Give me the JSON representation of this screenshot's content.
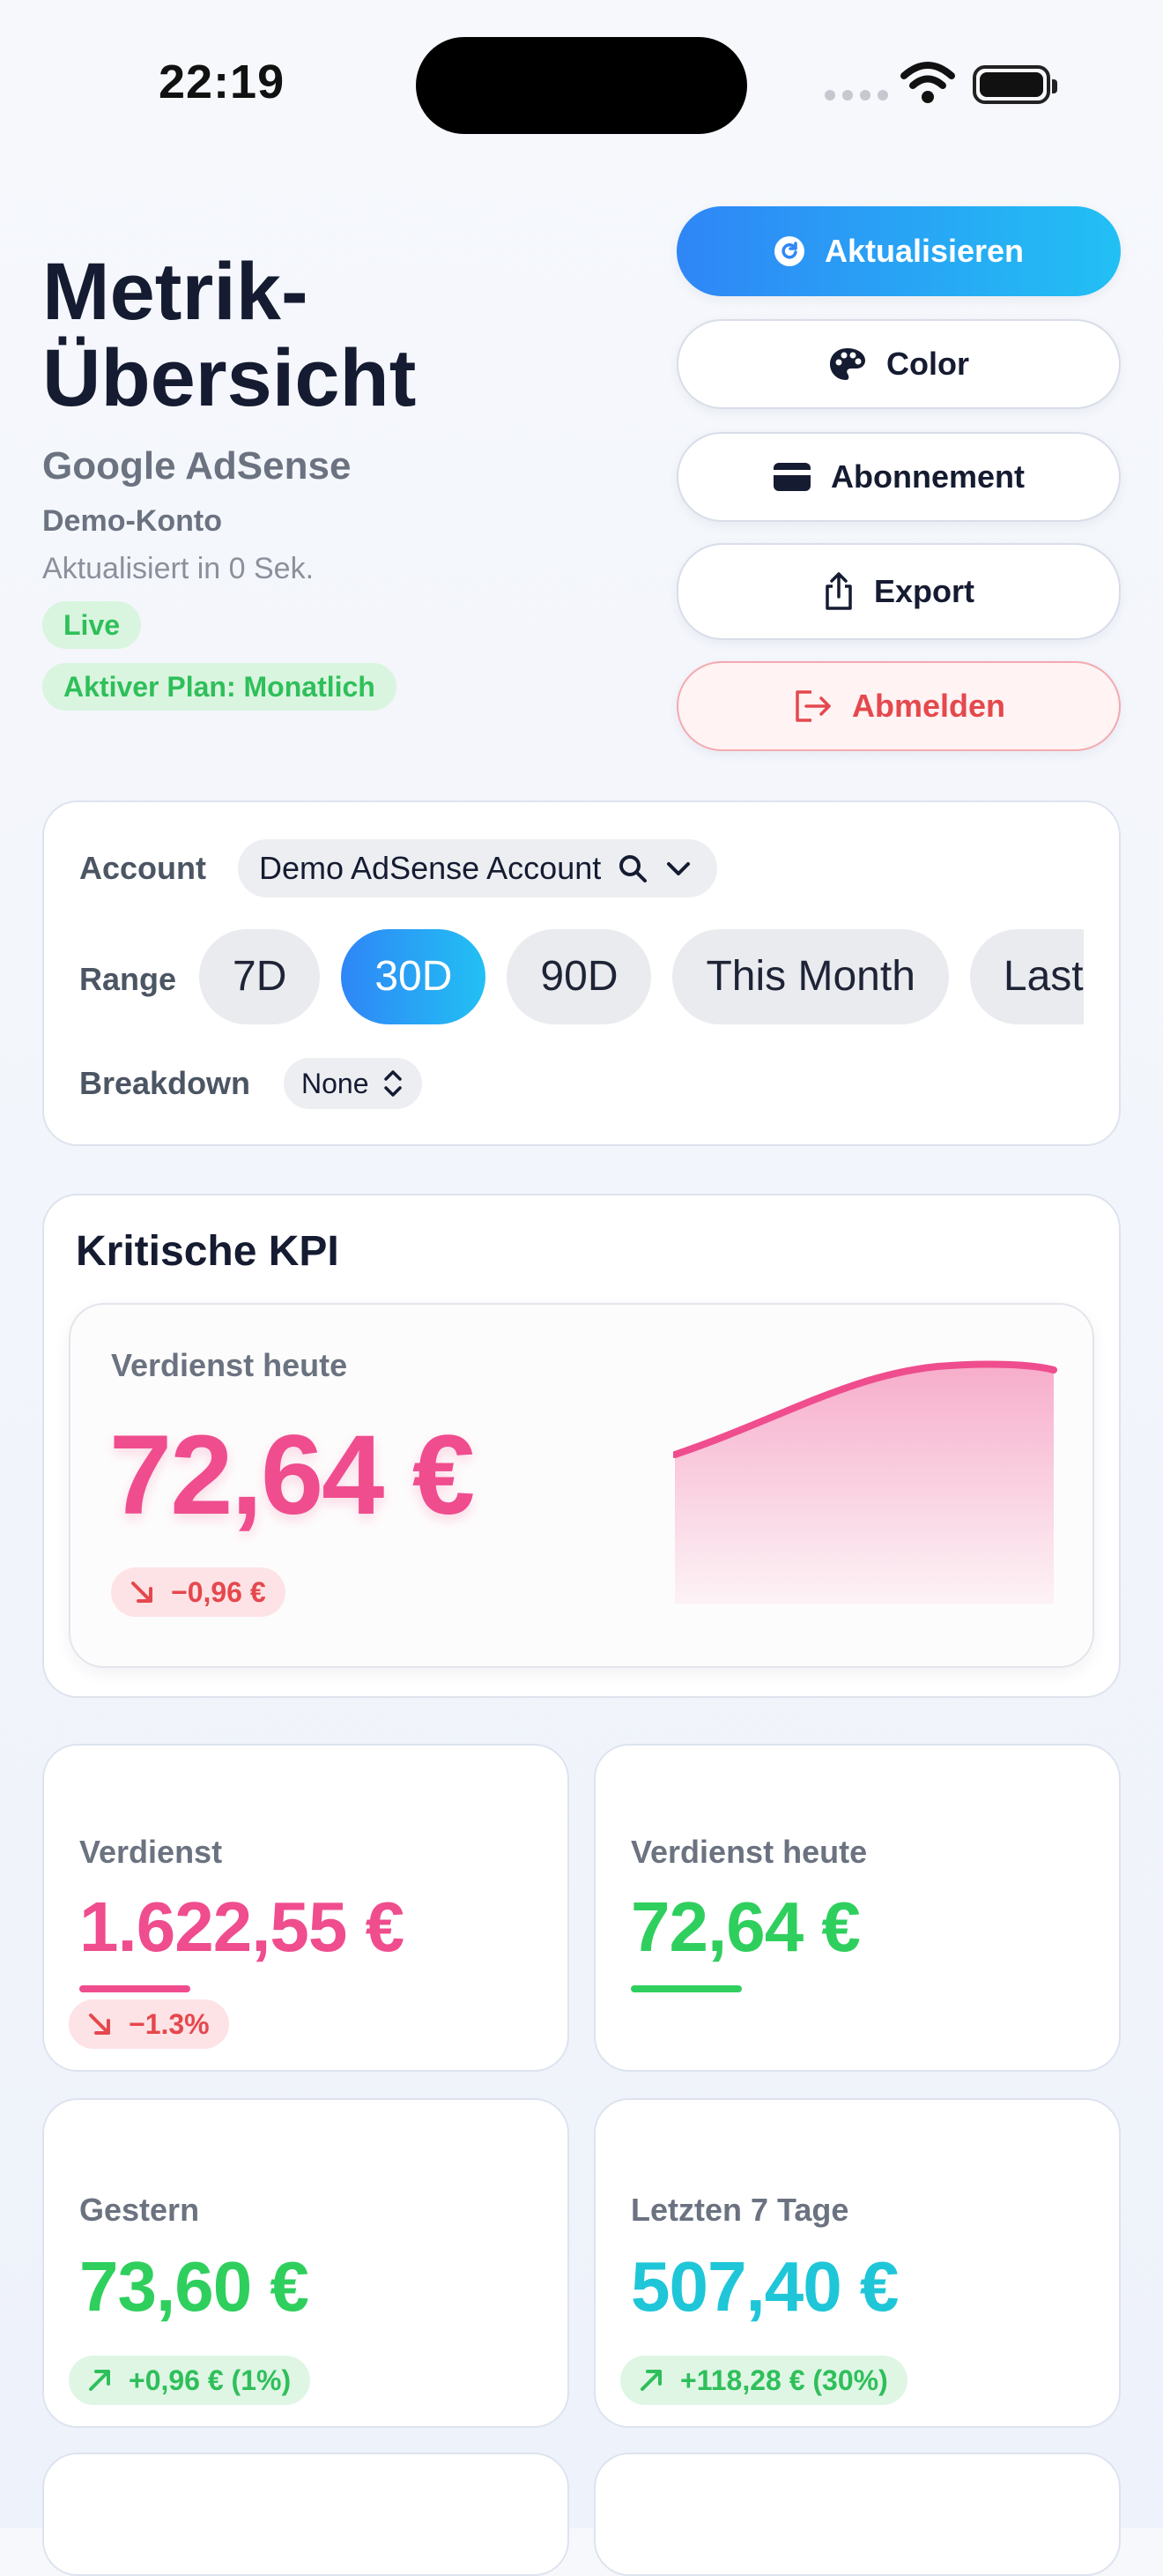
{
  "status_bar": {
    "time": "22:19"
  },
  "header": {
    "title": "Metrik-Übersicht",
    "service": "Google AdSense",
    "account_label": "Demo-Konto",
    "updated": "Aktualisiert in 0 Sek.",
    "live_badge": "Live",
    "plan_badge": "Aktiver Plan: Monatlich"
  },
  "actions": {
    "refresh": "Aktualisieren",
    "color": "Color",
    "subscription": "Abonnement",
    "export": "Export",
    "logout": "Abmelden"
  },
  "filters": {
    "account_label": "Account",
    "account_value": "Demo AdSense Account",
    "range_label": "Range",
    "ranges": [
      "7D",
      "30D",
      "90D",
      "This Month",
      "Last Month"
    ],
    "selected_range": "30D",
    "breakdown_label": "Breakdown",
    "breakdown_value": "None"
  },
  "kpi": {
    "section_title": "Kritische KPI",
    "label": "Verdienst heute",
    "value": "72,64 €",
    "delta": "−0,96 €",
    "accent_color": "#ef4d8e"
  },
  "metrics": [
    {
      "label": "Verdienst",
      "value": "1.622,55 €",
      "delta": "−1.3%",
      "trend": "down",
      "color": "#ef4d8e"
    },
    {
      "label": "Verdienst heute",
      "value": "72,64 €",
      "delta": "",
      "trend": "none",
      "color": "#2fcf5e"
    },
    {
      "label": "Gestern",
      "value": "73,60 €",
      "delta": "+0,96 € (1%)",
      "trend": "up",
      "color": "#2fcf5e"
    },
    {
      "label": "Letzten 7 Tage",
      "value": "507,40 €",
      "delta": "+118,28 € (30%)",
      "trend": "up",
      "color": "#1ec6d8"
    }
  ]
}
